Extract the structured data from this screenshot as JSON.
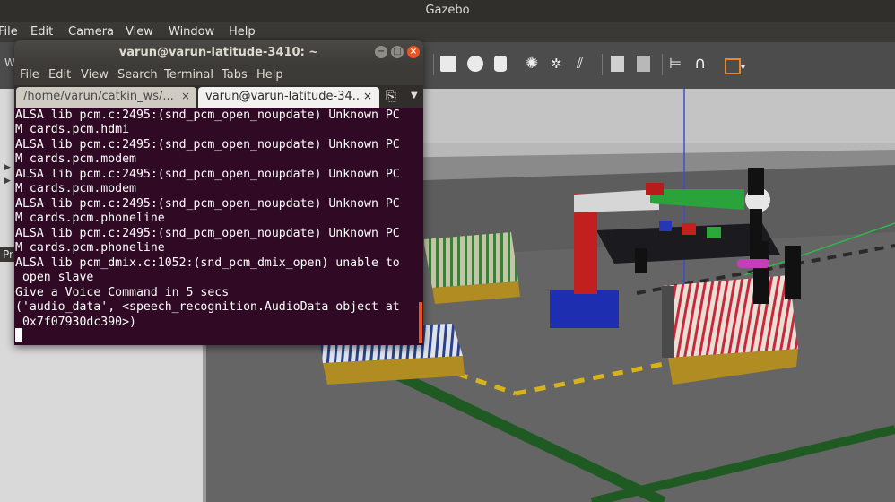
{
  "gazebo": {
    "title": "Gazebo",
    "menu": [
      "File",
      "Edit",
      "Camera",
      "View",
      "Window",
      "Help"
    ],
    "left_label_w": "W",
    "left_label_pr": "Pr"
  },
  "terminal": {
    "title": "varun@varun-latitude-3410: ~",
    "menu": [
      "File",
      "Edit",
      "View",
      "Search",
      "Terminal",
      "Tabs",
      "Help"
    ],
    "tabs": [
      {
        "label": "/home/varun/catkin_ws/...",
        "close": "×"
      },
      {
        "label": "varun@varun-latitude-34...",
        "close": "×"
      }
    ],
    "lines": [
      "ALSA lib pcm.c:2495:(snd_pcm_open_noupdate) Unknown PC",
      "M cards.pcm.hdmi",
      "ALSA lib pcm.c:2495:(snd_pcm_open_noupdate) Unknown PC",
      "M cards.pcm.modem",
      "ALSA lib pcm.c:2495:(snd_pcm_open_noupdate) Unknown PC",
      "M cards.pcm.modem",
      "ALSA lib pcm.c:2495:(snd_pcm_open_noupdate) Unknown PC",
      "M cards.pcm.phoneline",
      "ALSA lib pcm.c:2495:(snd_pcm_open_noupdate) Unknown PC",
      "M cards.pcm.phoneline",
      "ALSA lib pcm_dmix.c:1052:(snd_pcm_dmix_open) unable to",
      " open slave",
      "Give a Voice Command in 5 secs",
      "('audio_data', <speech_recognition.AudioData object at",
      " 0x7f07930dc390>)"
    ]
  },
  "colors": {
    "terminal_bg": "#300a24",
    "accent": "#e95420"
  }
}
